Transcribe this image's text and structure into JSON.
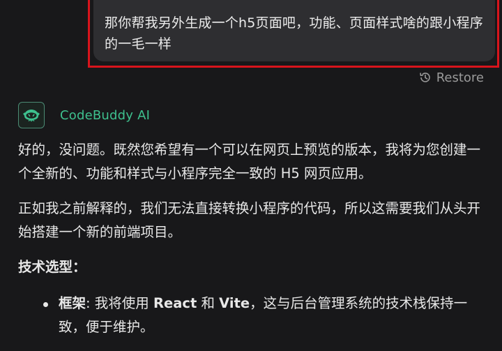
{
  "user_message": {
    "text": "那你帮我另外生成一个h5页面吧，功能、页面样式啥的跟小程序的一毛一样"
  },
  "restore": {
    "label": "Restore",
    "icon": "history-icon"
  },
  "assistant": {
    "name": "CodeBuddy AI",
    "avatar_icon": "codebuddy-logo-icon",
    "accent_color": "#3ec08e",
    "paragraph_1": "好的，没问题。既然您希望有一个可以在网页上预览的版本，我将为您创建一个全新的、功能和样式与小程序完全一致的 H5 网页应用。",
    "paragraph_2": "正如我之前解释的，我们无法直接转换小程序的代码，所以这需要我们从头开始搭建一个新的前端项目。",
    "section_heading": "技术选型：",
    "list": [
      {
        "label": "框架",
        "sep": ": 我将使用 ",
        "tech_1": "React",
        "and": " 和 ",
        "tech_2": "Vite",
        "rest": "，这与后台管理系统的技术栈保持一致，便于维护。"
      }
    ]
  },
  "highlight_color": "#d8141c"
}
